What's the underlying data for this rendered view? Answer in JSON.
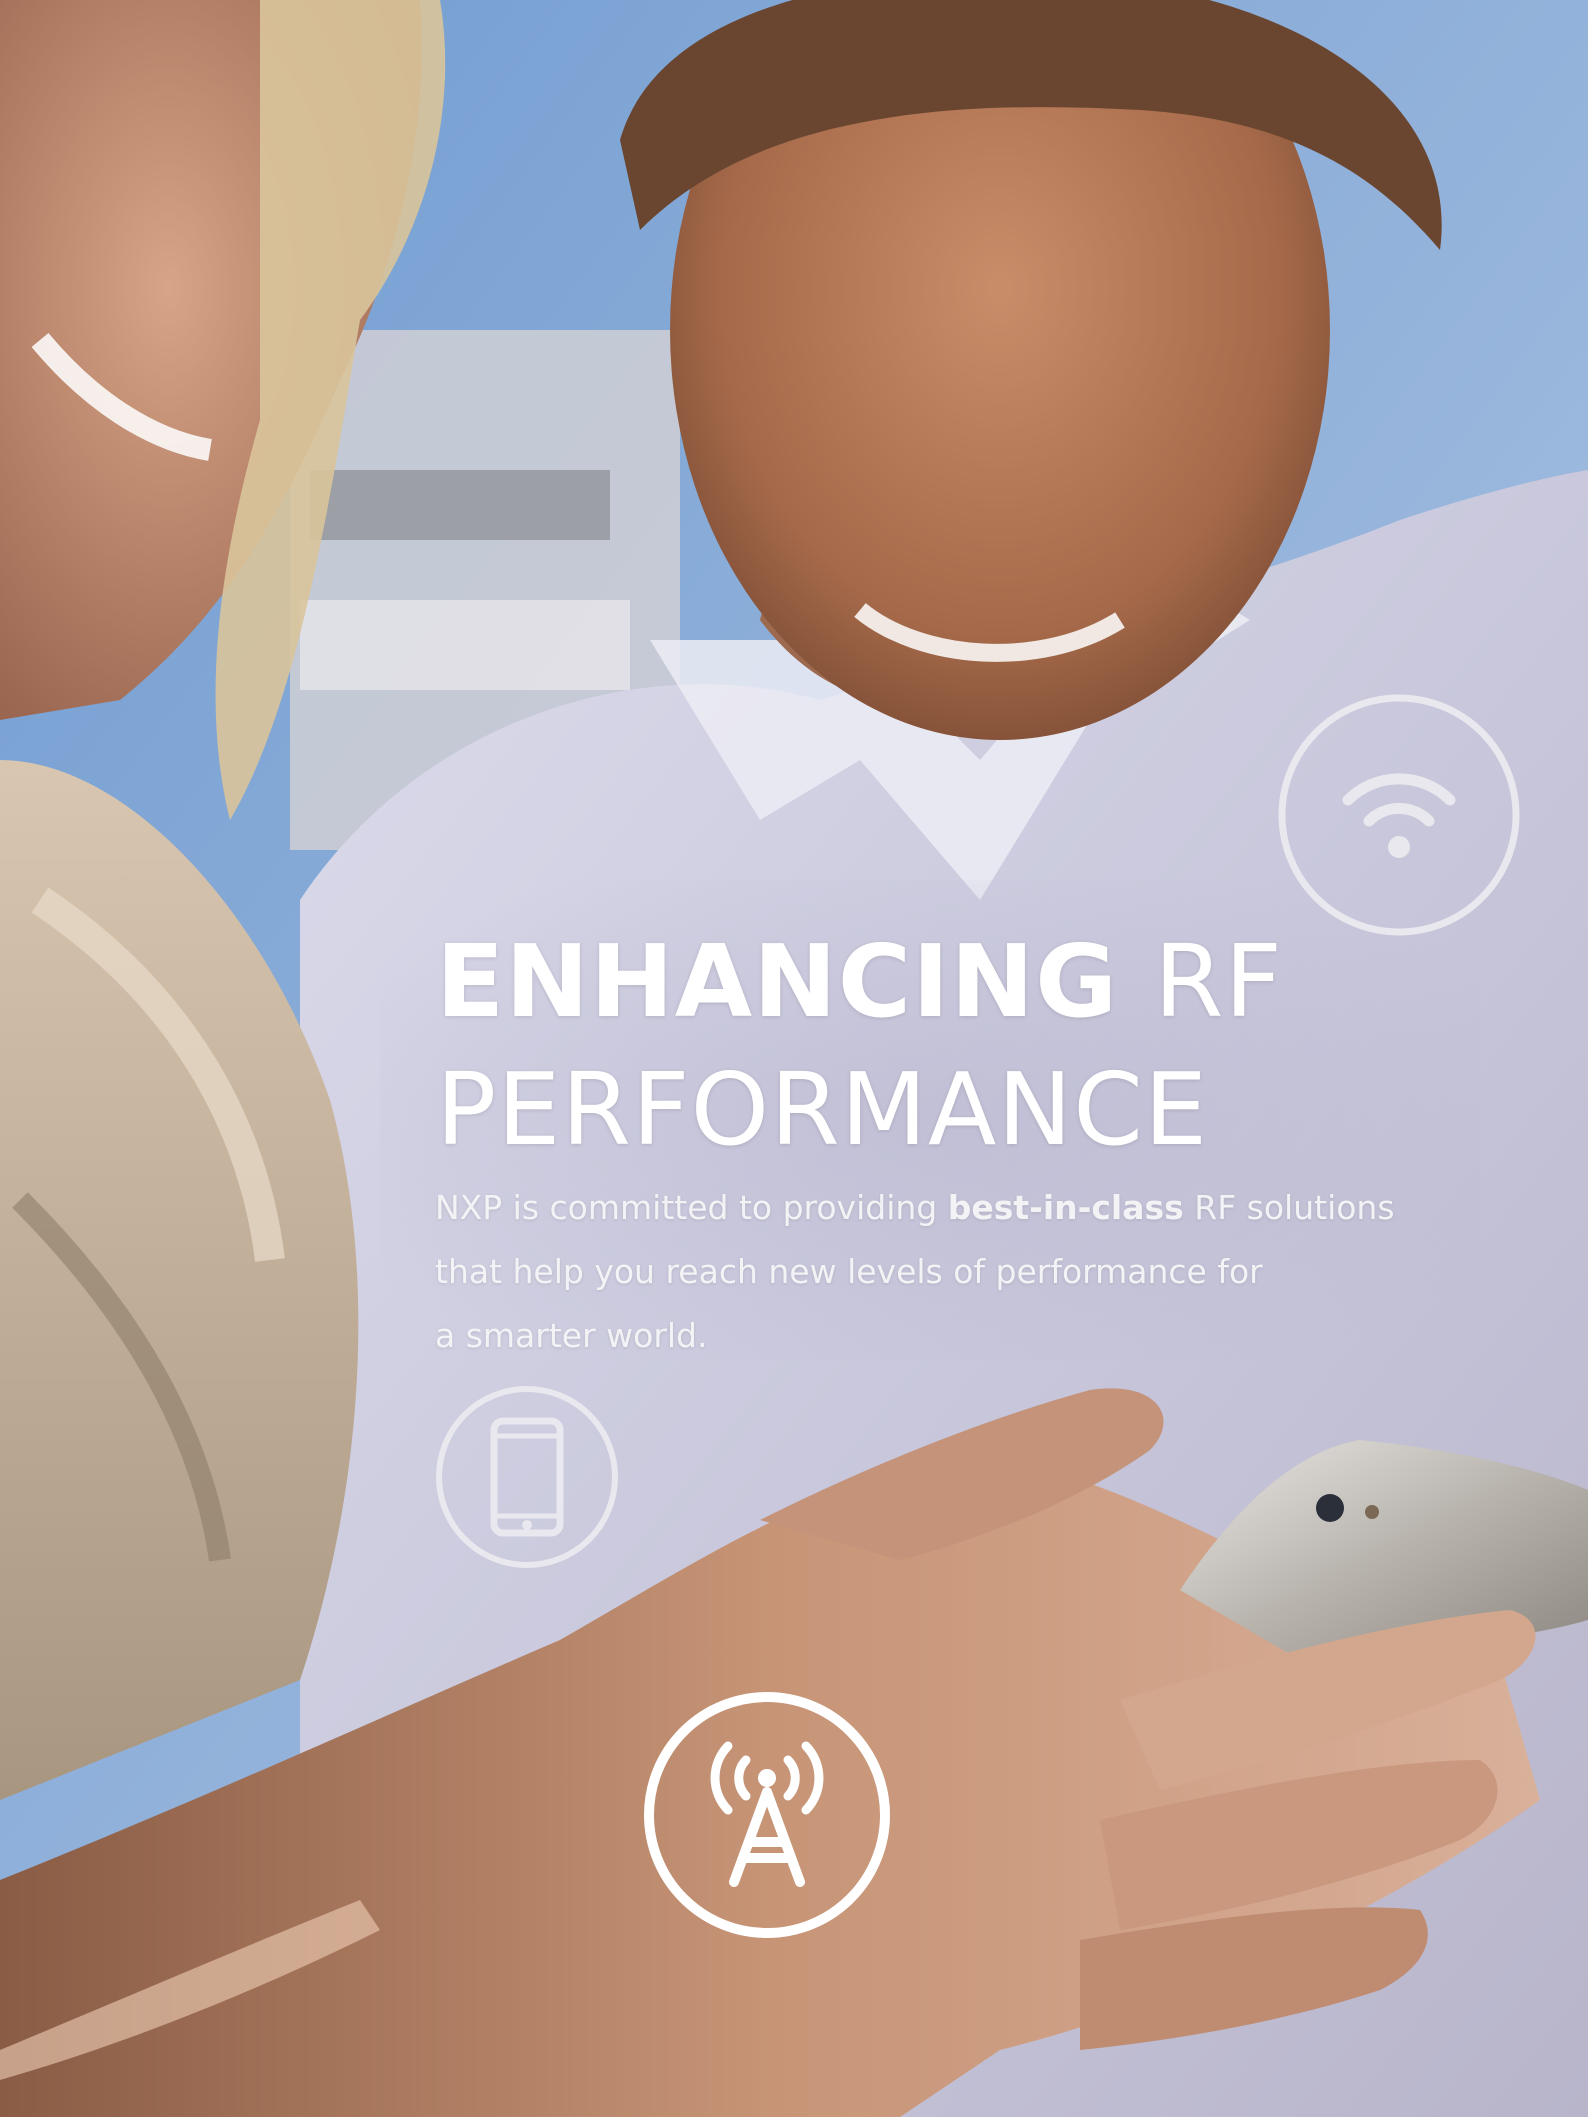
{
  "hero": {
    "title_bold": "ENHANCING",
    "title_light_1": "RF",
    "title_light_2": "PERFORMANCE"
  },
  "intro": {
    "part1": "NXP is committed to providing",
    "highlight": "best-in-class",
    "part2": "RF solutions",
    "line2": "that help you reach new levels of performance for",
    "line3": "a smarter world."
  },
  "icons": [
    {
      "name": "wifi-icon"
    },
    {
      "name": "smartphone-icon"
    },
    {
      "name": "cell-tower-icon"
    }
  ],
  "colors": {
    "icon_stroke": "#e8e8ee",
    "text": "#ffffff",
    "sky": "#7fa7d6"
  }
}
